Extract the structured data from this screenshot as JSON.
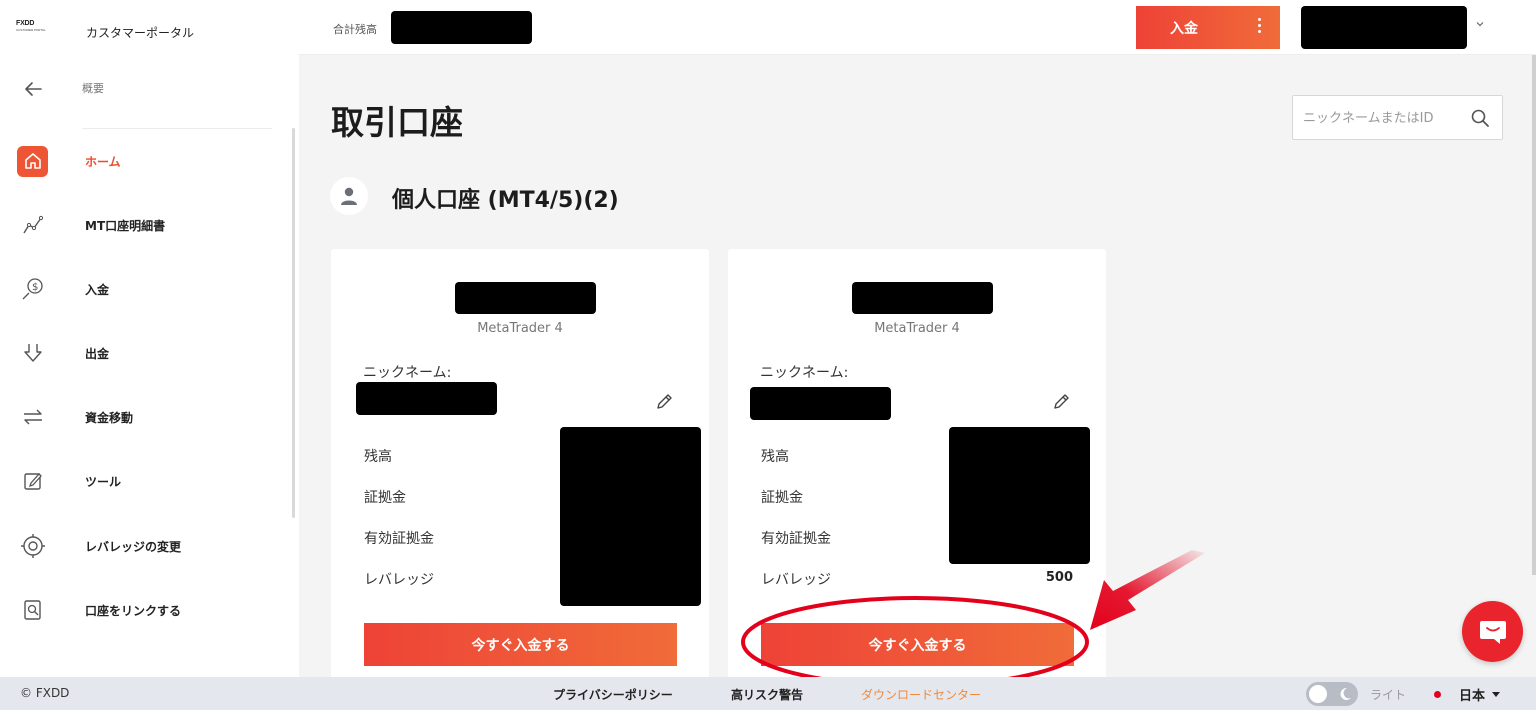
{
  "sidebar": {
    "logo_text": "FXDD",
    "logo_subtext": "CUSTOMER PORTAL",
    "portal_title": "カスタマーポータル",
    "overview": "概要",
    "items": [
      {
        "label": "ホーム",
        "icon": "home-icon",
        "active": true
      },
      {
        "label": "MT口座明細書",
        "icon": "chart-line-icon",
        "active": false
      },
      {
        "label": "入金",
        "icon": "deposit-coin-icon",
        "active": false
      },
      {
        "label": "出金",
        "icon": "withdraw-arrow-icon",
        "active": false
      },
      {
        "label": "資金移動",
        "icon": "transfer-arrows-icon",
        "active": false
      },
      {
        "label": "ツール",
        "icon": "edit-icon",
        "active": false
      },
      {
        "label": "レバレッジの変更",
        "icon": "lifebuoy-icon",
        "active": false
      },
      {
        "label": "口座をリンクする",
        "icon": "link-account-icon",
        "active": false
      }
    ]
  },
  "header": {
    "balance_label": "合計残高",
    "deposit_label": "入金"
  },
  "main": {
    "title": "取引口座",
    "search_placeholder": "ニックネームまたはID",
    "section_title": "個人口座 (MT4/5)(2)",
    "cards": [
      {
        "platform": "MetaTrader 4",
        "nickname_label": "ニックネーム:",
        "rows": [
          "残高",
          "証拠金",
          "有効証拠金",
          "レバレッジ"
        ],
        "leverage": "",
        "cta": "今すぐ入金する"
      },
      {
        "platform": "MetaTrader 4",
        "nickname_label": "ニックネーム:",
        "rows": [
          "残高",
          "証拠金",
          "有効証拠金",
          "レバレッジ"
        ],
        "leverage": "500",
        "cta": "今すぐ入金する"
      }
    ]
  },
  "footer": {
    "copyright": "© FXDD",
    "links": [
      "プライバシーポリシー",
      "高リスク警告",
      "ダウンロードセンター"
    ],
    "theme_label": "ライト",
    "language": "日本"
  },
  "colors": {
    "accent": "#ee4c2e",
    "annotation": "#e3001b",
    "footer_bg": "#e5e7ef"
  }
}
